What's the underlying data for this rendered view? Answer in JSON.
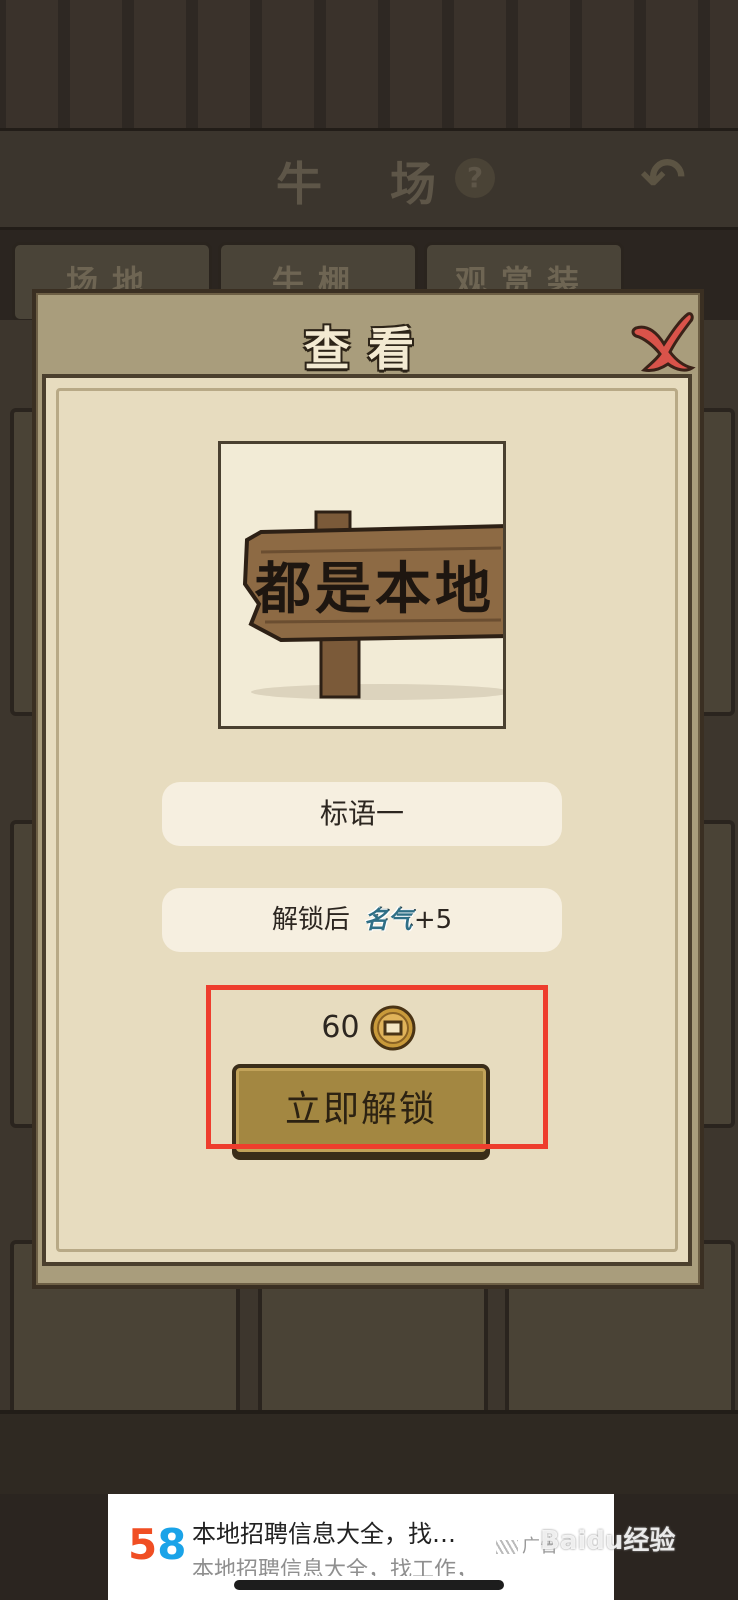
{
  "background": {
    "header_title": "牛 场",
    "help_icon": "question-mark",
    "back_icon": "back-arrow",
    "tabs": [
      "场地",
      "牛棚",
      "观赏装"
    ]
  },
  "modal": {
    "title": "查看",
    "close_icon": "close-x",
    "item_image_text": "都是本地",
    "item_name": "标语一",
    "effect_prefix": "解锁后",
    "effect_stat": "名气",
    "effect_value": "+5",
    "price": "60",
    "currency_icon": "copper-coin",
    "unlock_button": "立即解锁",
    "highlight_color": "#ee3d2d"
  },
  "ad": {
    "logo_5": "5",
    "logo_8": "8",
    "title": "本地招聘信息大全，找…",
    "subtitle": "本地招聘信息大全，找工作，",
    "tag": "广告"
  },
  "watermark": "Baidu经验"
}
